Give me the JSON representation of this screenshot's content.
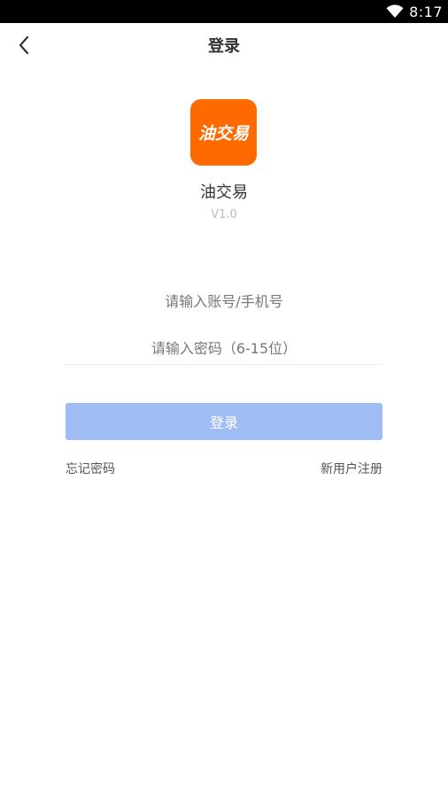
{
  "status_bar": {
    "time": "8:17",
    "icons": [
      "wifi-icon"
    ]
  },
  "nav": {
    "title": "登录",
    "back_icon": "chevron-left-icon"
  },
  "app": {
    "logo_text": "油交易",
    "name": "油交易",
    "version": "V1.0",
    "brand_color": "#ff6a00"
  },
  "form": {
    "account_placeholder": "请输入账号/手机号",
    "account_value": "",
    "password_placeholder": "请输入密码（6-15位）",
    "password_value": "",
    "login_label": "登录",
    "login_button_color": "#9fbdf4"
  },
  "links": {
    "forgot_password": "忘记密码",
    "register": "新用户注册"
  }
}
